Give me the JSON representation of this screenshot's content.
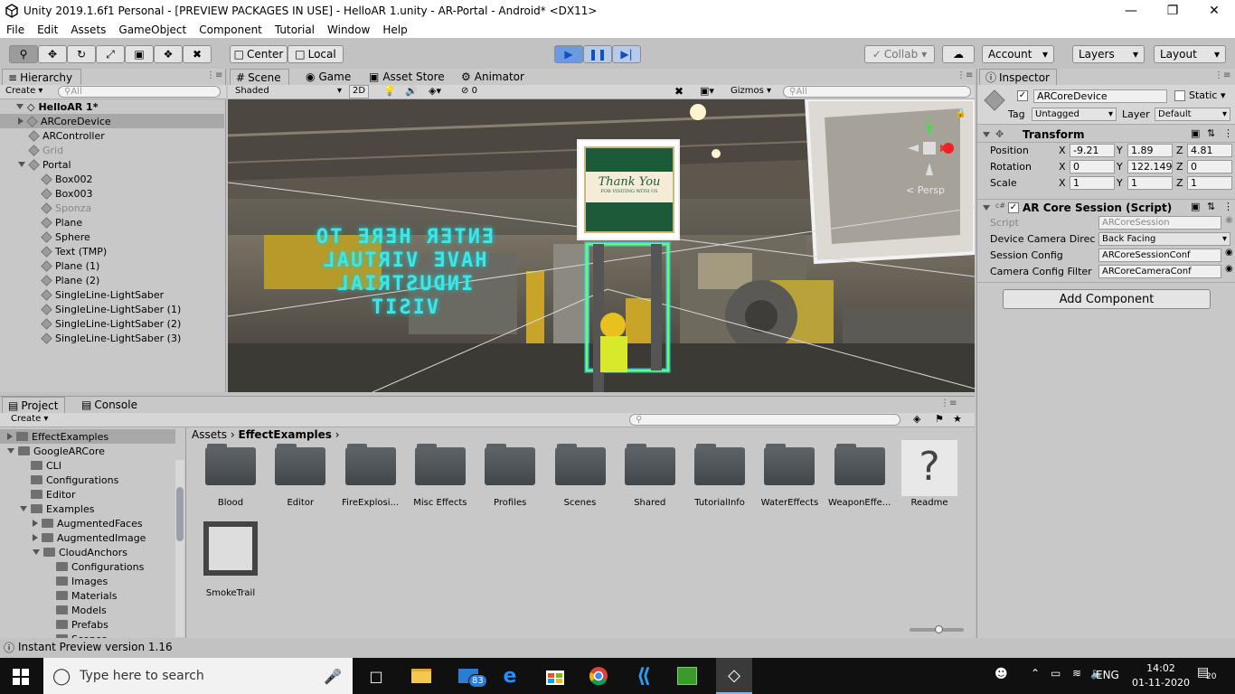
{
  "window": {
    "title": "Unity 2019.1.6f1 Personal - [PREVIEW PACKAGES IN USE] - HelloAR 1.unity - AR-Portal - Android* <DX11>"
  },
  "menu": [
    "File",
    "Edit",
    "Assets",
    "GameObject",
    "Component",
    "Tutorial",
    "Window",
    "Help"
  ],
  "toolbar": {
    "center": "Center",
    "local": "Local",
    "collab": "Collab",
    "account": "Account",
    "layers": "Layers",
    "layout": "Layout"
  },
  "hierarchy": {
    "tab": "Hierarchy",
    "create": "Create",
    "search_placeholder": "All",
    "scene": "HelloAR 1*",
    "items": [
      {
        "label": "ARCoreDevice",
        "indent": 1,
        "selected": true,
        "expand": "right"
      },
      {
        "label": "ARController",
        "indent": 1
      },
      {
        "label": "Grid",
        "indent": 1,
        "dim": true
      },
      {
        "label": "Portal",
        "indent": 1,
        "expand": "down"
      },
      {
        "label": "Box002",
        "indent": 2
      },
      {
        "label": "Box003",
        "indent": 2
      },
      {
        "label": "Sponza",
        "indent": 2,
        "dim": true
      },
      {
        "label": "Plane",
        "indent": 2
      },
      {
        "label": "Sphere",
        "indent": 2
      },
      {
        "label": "Text (TMP)",
        "indent": 2
      },
      {
        "label": "Plane (1)",
        "indent": 2
      },
      {
        "label": "Plane (2)",
        "indent": 2
      },
      {
        "label": "SingleLine-LightSaber",
        "indent": 2
      },
      {
        "label": "SingleLine-LightSaber (1)",
        "indent": 2
      },
      {
        "label": "SingleLine-LightSaber (2)",
        "indent": 2
      },
      {
        "label": "SingleLine-LightSaber (3)",
        "indent": 2
      }
    ]
  },
  "scene_tabs": [
    "Scene",
    "Game",
    "Asset Store",
    "Animator"
  ],
  "scene_bar": {
    "shading": "Shaded",
    "mode2d": "2D",
    "hidden_count": "0",
    "gizmos": "Gizmos",
    "search_placeholder": "All"
  },
  "scene_view": {
    "portal_text": [
      "ENTER HERE TO",
      "HAVE VIRTUAL",
      "INDUSTRIAL",
      "VISIT"
    ],
    "sign_text": "Thank You",
    "sign_sub": "FOR VISITING WITH US",
    "persp": "< Persp",
    "gizmo_axis": "y"
  },
  "inspector": {
    "tab": "Inspector",
    "object_name": "ARCoreDevice",
    "static": "Static",
    "tag_label": "Tag",
    "tag": "Untagged",
    "layer_label": "Layer",
    "layer": "Default",
    "transform": {
      "title": "Transform",
      "rows": [
        {
          "label": "Position",
          "x": "-9.21",
          "y": "1.89",
          "z": "4.81"
        },
        {
          "label": "Rotation",
          "x": "0",
          "y": "122.149",
          "z": "0"
        },
        {
          "label": "Scale",
          "x": "1",
          "y": "1",
          "z": "1"
        }
      ]
    },
    "session": {
      "title": "AR Core Session (Script)",
      "script_label": "Script",
      "script": "ARCoreSession",
      "camera_dir_label": "Device Camera Direc",
      "camera_dir": "Back Facing",
      "config_label": "Session Config",
      "config": "ARCoreSessionConf",
      "filter_label": "Camera Config Filter",
      "filter": "ARCoreCameraConf"
    },
    "add_component": "Add Component"
  },
  "project": {
    "tab": "Project",
    "console_tab": "Console",
    "create": "Create",
    "tree": [
      {
        "label": "EffectExamples",
        "indent": 1,
        "selected": true,
        "expand": "right"
      },
      {
        "label": "GoogleARCore",
        "indent": 1,
        "expand": "down"
      },
      {
        "label": "CLI",
        "indent": 2
      },
      {
        "label": "Configurations",
        "indent": 2
      },
      {
        "label": "Editor",
        "indent": 2
      },
      {
        "label": "Examples",
        "indent": 2,
        "expand": "down"
      },
      {
        "label": "AugmentedFaces",
        "indent": 3,
        "expand": "right"
      },
      {
        "label": "AugmentedImage",
        "indent": 3,
        "expand": "right"
      },
      {
        "label": "CloudAnchors",
        "indent": 3,
        "expand": "down"
      },
      {
        "label": "Configurations",
        "indent": 4
      },
      {
        "label": "Images",
        "indent": 4
      },
      {
        "label": "Materials",
        "indent": 4
      },
      {
        "label": "Models",
        "indent": 4
      },
      {
        "label": "Prefabs",
        "indent": 4
      },
      {
        "label": "Scenes",
        "indent": 4
      }
    ],
    "breadcrumb": [
      "Assets",
      "EffectExamples"
    ],
    "assets": [
      "Blood",
      "Editor",
      "FireExplosi...",
      "Misc Effects",
      "Profiles",
      "Scenes",
      "Shared",
      "TutorialInfo",
      "WaterEffects",
      "WeaponEffe...",
      "Readme",
      "SmokeTrail"
    ]
  },
  "status": "Instant Preview version 1.16",
  "taskbar": {
    "search_placeholder": "Type here to search",
    "mail_badge": "83",
    "lang": "ENG",
    "time": "14:02",
    "date": "01-11-2020",
    "notif": "20"
  }
}
